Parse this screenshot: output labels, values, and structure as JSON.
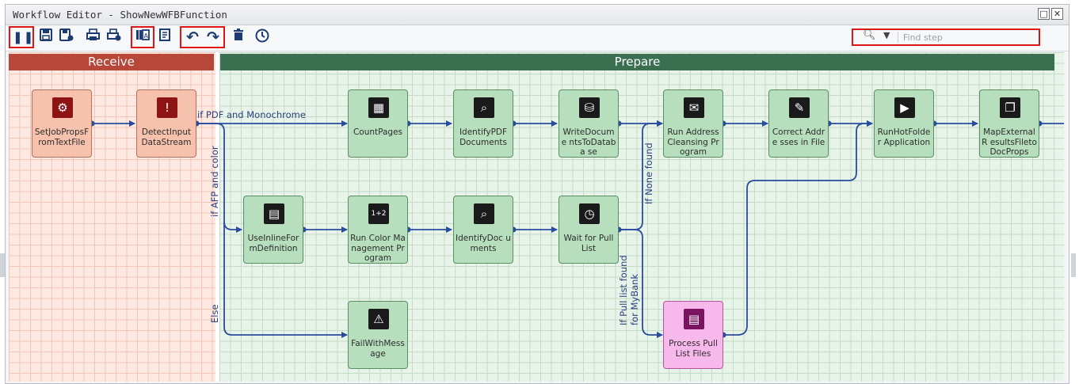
{
  "window": {
    "title": "Workflow Editor - ShowNewWFBFunction",
    "controls": [
      "maximize-icon",
      "close-icon"
    ]
  },
  "toolbar": {
    "buttons": [
      {
        "name": "pause-icon",
        "glyph": "❚❚"
      },
      {
        "name": "save-icon",
        "glyph": "💾"
      },
      {
        "name": "save-as-icon",
        "glyph": "🖫"
      },
      {
        "name": "print-icon",
        "glyph": "🖶"
      },
      {
        "name": "print-settings-icon",
        "glyph": "🖶"
      },
      {
        "name": "step-library-icon",
        "glyph": "▥"
      },
      {
        "name": "properties-icon",
        "glyph": "▤"
      },
      {
        "name": "undo-icon",
        "glyph": "↶"
      },
      {
        "name": "redo-icon",
        "glyph": "↷"
      },
      {
        "name": "delete-icon",
        "glyph": "🗑"
      },
      {
        "name": "history-icon",
        "glyph": "◷"
      }
    ],
    "search": {
      "placeholder": "Find step",
      "value": ""
    }
  },
  "zones": {
    "receive": "Receive",
    "prepare": "Prepare"
  },
  "nodes": [
    {
      "id": "SetJobPropsFromTextFile",
      "label": "SetJobPropsF romTextFile",
      "zone": "receive",
      "icon": "text-props-icon"
    },
    {
      "id": "DetectInputDataStream",
      "label": "DetectInput DataStream",
      "zone": "receive",
      "icon": "detect-icon"
    },
    {
      "id": "CountPages",
      "label": "CountPages",
      "zone": "prepare",
      "icon": "count-pages-icon"
    },
    {
      "id": "IdentifyPDFDocuments",
      "label": "IdentifyPDF Documents",
      "zone": "prepare",
      "icon": "identify-pdf-icon"
    },
    {
      "id": "WriteDocumentsToDatabase",
      "label": "WriteDocume ntsToDataba se",
      "zone": "prepare",
      "icon": "write-db-icon"
    },
    {
      "id": "RunAddressCleansingProgram",
      "label": "Run Address Cleansing Program",
      "zone": "prepare",
      "icon": "address-icon"
    },
    {
      "id": "CorrectAddressesInFile",
      "label": "Correct Addre sses in File",
      "zone": "prepare",
      "icon": "correct-icon"
    },
    {
      "id": "RunHotFolderApplication",
      "label": "RunHotFolder Application",
      "zone": "prepare",
      "icon": "hotfolder-icon"
    },
    {
      "id": "MapExternalResultsFiletoDocProps",
      "label": "MapExternalR esultsFileto DocProps",
      "zone": "prepare",
      "icon": "map-results-icon"
    },
    {
      "id": "UseInlineFormDefinition",
      "label": "UseInlineFor mDefinition",
      "zone": "prepare",
      "icon": "inline-form-icon"
    },
    {
      "id": "RunColorManagementProgram",
      "label": "Run Color Management Program",
      "zone": "prepare",
      "icon": "color-mgmt-icon"
    },
    {
      "id": "IdentifyDocuments",
      "label": "IdentifyDoc uments",
      "zone": "prepare",
      "icon": "identify-doc-icon"
    },
    {
      "id": "WaitForPullList",
      "label": "Wait for Pull List",
      "zone": "prepare",
      "icon": "clock-icon"
    },
    {
      "id": "FailWithMessage",
      "label": "FailWithMess age",
      "zone": "prepare",
      "icon": "warning-icon"
    },
    {
      "id": "ProcessPullListFiles",
      "label": "Process Pull List Files",
      "zone": "prepare",
      "icon": "process-files-icon"
    }
  ],
  "edge_labels": {
    "pdf_mono": "if PDF and Monochrome",
    "afp_color": "if AFP and color",
    "else": "Else",
    "none_found": "If None found",
    "pull_list_found_line1": "If Pull list found",
    "pull_list_found_line2": "for MyBank"
  }
}
